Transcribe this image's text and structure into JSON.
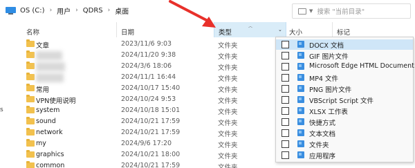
{
  "address": {
    "crumbs": [
      "OS (C:)",
      "用户",
      "QDRS",
      "桌面"
    ]
  },
  "search": {
    "placeholder": "搜索 \"当前目录\""
  },
  "columns": {
    "name": "名称",
    "date": "日期",
    "type": "类型",
    "size": "大小",
    "tags": "标记"
  },
  "files": [
    {
      "name": "文章",
      "date": "2023/11/6 9:03",
      "type": "文件夹"
    },
    {
      "name": "",
      "date": "2024/11/20 9:38",
      "type": "文件夹"
    },
    {
      "name": "",
      "date": "2024/3/6 18:06",
      "type": "文件夹"
    },
    {
      "name": "",
      "date": "2024/11/1 16:44",
      "type": "文件夹"
    },
    {
      "name": "常用",
      "date": "2024/10/17 15:40",
      "type": "文件夹"
    },
    {
      "name": "VPN使用说明",
      "date": "2024/10/24 9:53",
      "type": "文件夹"
    },
    {
      "name": "system",
      "date": "2024/10/18 15:01",
      "type": "文件夹"
    },
    {
      "name": "sound",
      "date": "2024/10/21 17:59",
      "type": "文件夹"
    },
    {
      "name": "network",
      "date": "2024/10/21 17:59",
      "type": "文件夹"
    },
    {
      "name": "my",
      "date": "2024/9/6 17:20",
      "type": "文件夹"
    },
    {
      "name": "graphics",
      "date": "2024/10/21 18:00",
      "type": "文件夹"
    },
    {
      "name": "common",
      "date": "2024/10/21 17:59",
      "type": "文件夹"
    }
  ],
  "left_edge_char": "s",
  "filter_options": [
    "DOCX 文档",
    "GIF 图片文件",
    "Microsoft Edge HTML Document",
    "MP4 文件",
    "PNG 图片文件",
    "VBScript Script 文件",
    "XLSX 工作表",
    "快捷方式",
    "文本文档",
    "文件夹",
    "应用程序"
  ],
  "colors": {
    "type_header_highlight": "#d9ecf8",
    "hover_option": "#cfe6f8",
    "folder": "#f2c14e",
    "arrow": "#e8302a",
    "type_icon": "#3a8ee0"
  }
}
